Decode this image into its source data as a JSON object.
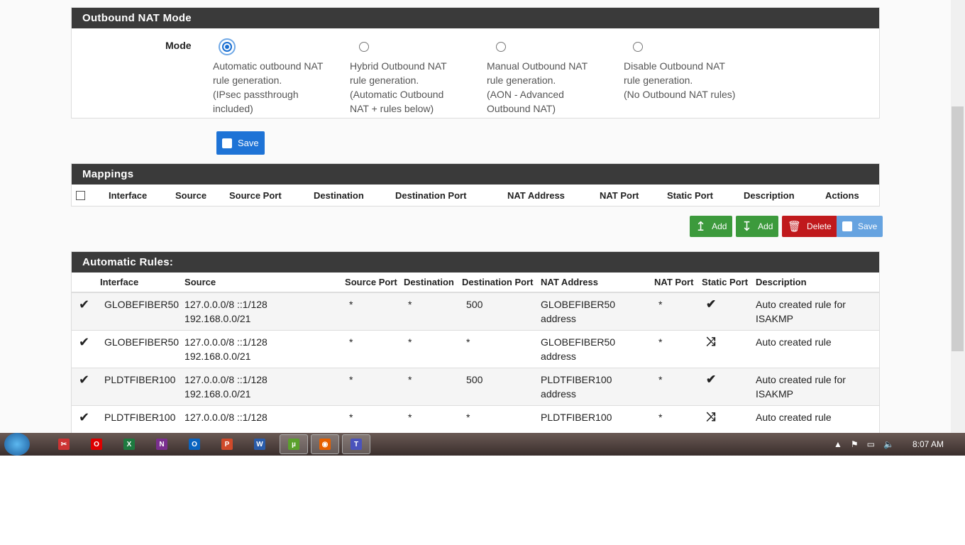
{
  "outbound": {
    "title": "Outbound NAT Mode",
    "mode_label": "Mode",
    "options": [
      {
        "lines": [
          "Automatic outbound NAT",
          "rule generation.",
          "(IPsec passthrough",
          "included)"
        ],
        "selected": true
      },
      {
        "lines": [
          "Hybrid Outbound NAT",
          "rule generation.",
          "(Automatic Outbound",
          "NAT + rules below)"
        ],
        "selected": false
      },
      {
        "lines": [
          "Manual Outbound NAT",
          "rule generation.",
          "(AON - Advanced",
          "Outbound NAT)"
        ],
        "selected": false
      },
      {
        "lines": [
          "Disable Outbound NAT",
          "rule generation.",
          "(No Outbound NAT rules)"
        ],
        "selected": false
      }
    ],
    "save": "Save"
  },
  "mappings": {
    "title": "Mappings",
    "columns": [
      "Interface",
      "Source",
      "Source Port",
      "Destination",
      "Destination Port",
      "NAT Address",
      "NAT Port",
      "Static Port",
      "Description",
      "Actions"
    ],
    "buttons": {
      "add_top": "Add",
      "add_bottom": "Add",
      "delete": "Delete",
      "save": "Save"
    }
  },
  "auto": {
    "title": "Automatic Rules:",
    "columns": [
      "Interface",
      "Source",
      "Source Port",
      "Destination",
      "Destination Port",
      "NAT Address",
      "NAT Port",
      "Static Port",
      "Description"
    ],
    "rows": [
      {
        "interface": "GLOBEFIBER50",
        "source": [
          "127.0.0.0/8 ::1/128",
          "192.168.0.0/21"
        ],
        "sport": "*",
        "dest": "*",
        "dport": "500",
        "nat": [
          "GLOBEFIBER50",
          "address"
        ],
        "natport": "*",
        "static": "check",
        "desc": [
          "Auto created rule for",
          "ISAKMP"
        ]
      },
      {
        "interface": "GLOBEFIBER50",
        "source": [
          "127.0.0.0/8 ::1/128",
          "192.168.0.0/21"
        ],
        "sport": "*",
        "dest": "*",
        "dport": "*",
        "nat": [
          "GLOBEFIBER50",
          "address"
        ],
        "natport": "*",
        "static": "random",
        "desc": [
          "Auto created rule",
          ""
        ]
      },
      {
        "interface": "PLDTFIBER100",
        "source": [
          "127.0.0.0/8 ::1/128",
          "192.168.0.0/21"
        ],
        "sport": "*",
        "dest": "*",
        "dport": "500",
        "nat": [
          "PLDTFIBER100",
          "address"
        ],
        "natport": "*",
        "static": "check",
        "desc": [
          "Auto created rule for",
          "ISAKMP"
        ]
      },
      {
        "interface": "PLDTFIBER100",
        "source": [
          "127.0.0.0/8 ::1/128",
          ""
        ],
        "sport": "*",
        "dest": "*",
        "dport": "*",
        "nat": [
          "PLDTFIBER100",
          ""
        ],
        "natport": "*",
        "static": "random",
        "desc": [
          "Auto created rule",
          ""
        ]
      }
    ]
  },
  "taskbar": {
    "apps": [
      "snipping-tool",
      "opera",
      "excel",
      "onenote",
      "outlook",
      "powerpoint",
      "word",
      "utorrent",
      "firefox",
      "teams"
    ],
    "clock": "8:07 AM"
  }
}
